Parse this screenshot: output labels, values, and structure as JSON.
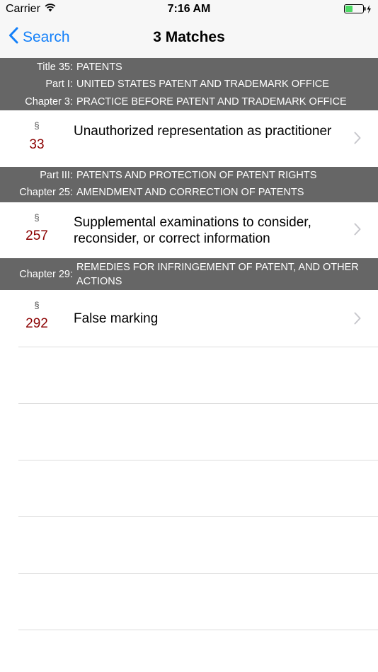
{
  "status_bar": {
    "carrier": "Carrier",
    "time": "7:16 AM"
  },
  "nav": {
    "back_label": "Search",
    "title": "3 Matches"
  },
  "sections": [
    {
      "headers": [
        {
          "label": "Title 35:",
          "value": "PATENTS"
        },
        {
          "label": "Part I:",
          "value": "UNITED STATES PATENT AND TRADEMARK OFFICE"
        },
        {
          "label": "Chapter 3:",
          "value": "PRACTICE BEFORE PATENT AND TRADEMARK OFFICE"
        }
      ],
      "row": {
        "symbol": "§",
        "number": "33",
        "title": "Unauthorized representation as practitioner"
      }
    },
    {
      "headers": [
        {
          "label": "Part III:",
          "value": "PATENTS AND PROTECTION OF PATENT RIGHTS"
        },
        {
          "label": "Chapter 25:",
          "value": "AMENDMENT AND CORRECTION OF PATENTS"
        }
      ],
      "row": {
        "symbol": "§",
        "number": "257",
        "title": "Supplemental examinations to consider, reconsider, or correct information"
      }
    },
    {
      "headers": [
        {
          "label": "Chapter 29:",
          "value": "REMEDIES FOR INFRINGEMENT OF PATENT, AND OTHER ACTIONS"
        }
      ],
      "row": {
        "symbol": "§",
        "number": "292",
        "title": "False marking"
      }
    }
  ],
  "colors": {
    "accent": "#1480f9",
    "section_number": "#8b0000",
    "header_bg": "#666666",
    "battery": "#4cd964"
  },
  "icons": {
    "back": "chevron-left-icon",
    "disclosure": "chevron-right-icon",
    "wifi": "wifi-icon",
    "battery": "battery-icon",
    "charging": "bolt-icon"
  }
}
